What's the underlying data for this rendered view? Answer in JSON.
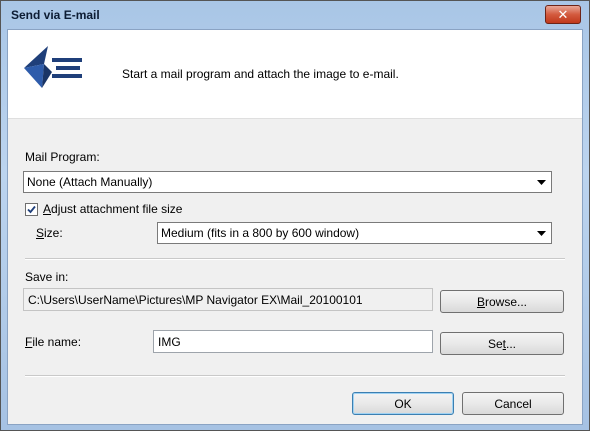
{
  "window": {
    "title": "Send via E-mail",
    "close_label": "✕"
  },
  "header": {
    "icon": "mail-send-icon",
    "description": "Start a mail program and attach the image to e-mail."
  },
  "mail_program": {
    "label": "Mail Program:",
    "value": "None (Attach Manually)"
  },
  "adjust_size": {
    "label_prefix": "",
    "label_accel": "A",
    "label_rest": "djust attachment file size",
    "checked": true
  },
  "size": {
    "label_accel": "S",
    "label_rest": "ize:",
    "value": "Medium (fits in a 800 by 600 window)"
  },
  "save_in": {
    "label": "Save in:",
    "path": "C:\\Users\\UserName\\Pictures\\MP Navigator EX\\Mail_20100101",
    "browse_accel": "B",
    "browse_rest": "rowse..."
  },
  "file_name": {
    "label_accel": "F",
    "label_rest": "ile name:",
    "value": "IMG",
    "set_prefix": "Se",
    "set_accel": "t",
    "set_rest": "..."
  },
  "buttons": {
    "ok": "OK",
    "cancel": "Cancel"
  },
  "colors": {
    "title_bar": "#bcd4ef",
    "close_button": "#c9472a",
    "dialog_bg": "#f0f0f0",
    "default_button_border": "#3c7fb1"
  }
}
